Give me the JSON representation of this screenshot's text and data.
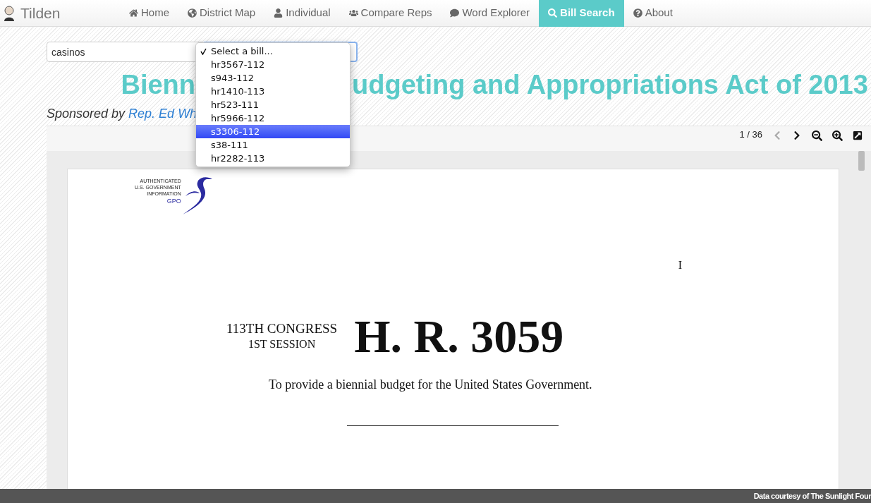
{
  "brand": {
    "name": "Tilden"
  },
  "nav": [
    {
      "label": "Home",
      "kind": "home",
      "selected": false
    },
    {
      "label": "District Map",
      "kind": "globe",
      "selected": false
    },
    {
      "label": "Individual",
      "kind": "user",
      "selected": false
    },
    {
      "label": "Compare Reps",
      "kind": "users",
      "selected": false
    },
    {
      "label": "Word Explorer",
      "kind": "comment",
      "selected": false
    },
    {
      "label": "Bill Search",
      "kind": "search",
      "selected": true
    },
    {
      "label": "About",
      "kind": "question",
      "selected": false
    }
  ],
  "search": {
    "value": "casinos"
  },
  "bill_select": {
    "options": [
      {
        "label": "Select a bill...",
        "selected": true,
        "highlighted": false
      },
      {
        "label": "hr3567-112",
        "selected": false,
        "highlighted": false
      },
      {
        "label": "s943-112",
        "selected": false,
        "highlighted": false
      },
      {
        "label": "hr1410-113",
        "selected": false,
        "highlighted": false
      },
      {
        "label": "hr523-111",
        "selected": false,
        "highlighted": false
      },
      {
        "label": "hr5966-112",
        "selected": false,
        "highlighted": false
      },
      {
        "label": "s3306-112",
        "selected": false,
        "highlighted": true
      },
      {
        "label": "s38-111",
        "selected": false,
        "highlighted": false
      },
      {
        "label": "hr2282-113",
        "selected": false,
        "highlighted": false
      }
    ]
  },
  "bill": {
    "title_start": "Bienn",
    "title_end": "udgeting and Appropriations Act of 2013",
    "sponsor_prefix": "Sponsored by",
    "sponsor": "Rep. Ed Wh"
  },
  "viewer": {
    "page_count": "1 / 36",
    "document": {
      "logo_lines": [
        "AUTHENTICATED",
        "U.S. GOVERNMENT",
        "INFORMATION"
      ],
      "logo_mark": "GPO",
      "numeral": "I",
      "congress": "113TH CONGRESS",
      "session": "1ST SESSION",
      "bill_number": "H. R. 3059",
      "purpose": "To provide a biennial budget for the United States Government."
    }
  },
  "footer": {
    "text": "Data courtesy of The Sunlight Four"
  }
}
